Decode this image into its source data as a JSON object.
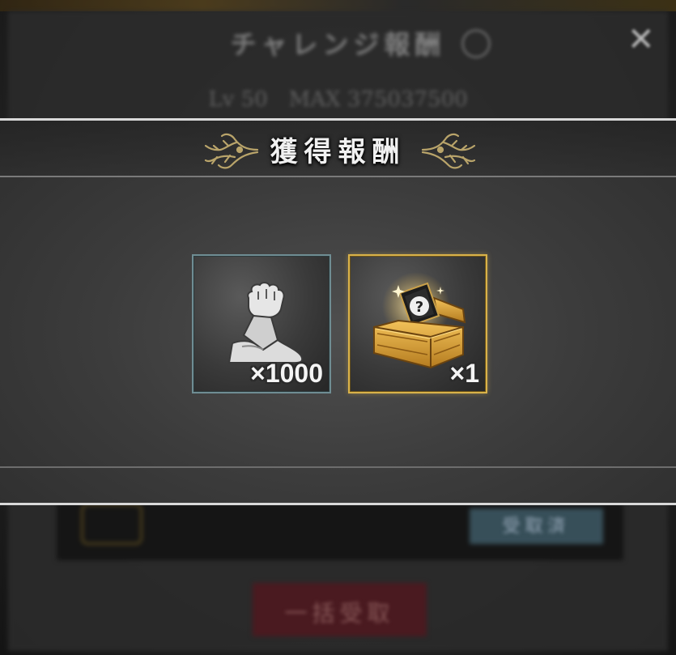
{
  "background": {
    "dialog_title": "チャレンジ報酬",
    "info_icon": "info-icon",
    "close_symbol": "✕",
    "subline": "Lv 50　MAX 375037500",
    "row_button_label": "受取済",
    "bottom_button_label": "一括受取"
  },
  "modal": {
    "title": "獲得報酬",
    "ornament_icon": "thorn-ornament-icon",
    "colors": {
      "frame_line": "#d9d9d9",
      "strength_border": "#6f8d93",
      "chest_border": "#d9b24a"
    }
  },
  "rewards": [
    {
      "icon": "flexed-arm-icon",
      "quantity": "×1000"
    },
    {
      "icon": "mystery-chest-icon",
      "quantity": "×1"
    }
  ]
}
